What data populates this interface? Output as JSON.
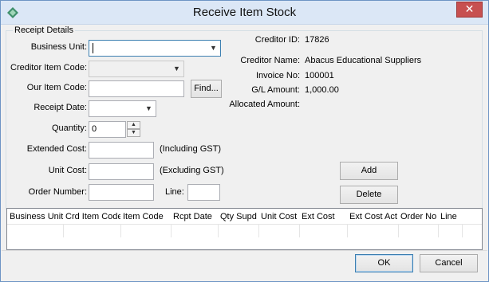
{
  "window": {
    "title": "Receive Item Stock",
    "close_glyph": "✕"
  },
  "group": {
    "legend": "Receipt Details"
  },
  "form": {
    "business_unit_label": "Business Unit:",
    "creditor_item_code_label": "Creditor Item Code:",
    "our_item_code_label": "Our Item Code:",
    "find_button": "Find...",
    "receipt_date_label": "Receipt Date:",
    "quantity_label": "Quantity:",
    "quantity_value": "0",
    "extended_cost_label": "Extended Cost:",
    "extended_cost_note": "(Including GST)",
    "unit_cost_label": "Unit Cost:",
    "unit_cost_note": "(Excluding GST)",
    "order_number_label": "Order Number:",
    "line_label": "Line:"
  },
  "info": {
    "creditor_id_label": "Creditor ID:",
    "creditor_id_value": "17826",
    "creditor_name_label": "Creditor Name:",
    "creditor_name_value": "Abacus Educational Suppliers",
    "invoice_no_label": "Invoice No:",
    "invoice_no_value": "100001",
    "gl_amount_label": "G/L Amount:",
    "gl_amount_value": "1,000.00",
    "allocated_amount_label": "Allocated Amount:"
  },
  "actions": {
    "add": "Add",
    "delete": "Delete"
  },
  "grid": {
    "columns": [
      "Business Unit",
      "Crd Item Code",
      "Item Code",
      "Rcpt Date",
      "Qty Supd",
      "Unit Cost",
      "Ext Cost",
      "Ext Cost Act",
      "Order No",
      "Line"
    ]
  },
  "footer": {
    "ok": "OK",
    "cancel": "Cancel"
  },
  "colors": {
    "accent": "#3c7fb1",
    "close": "#c75050",
    "titlebar": "#dbe7f6"
  }
}
